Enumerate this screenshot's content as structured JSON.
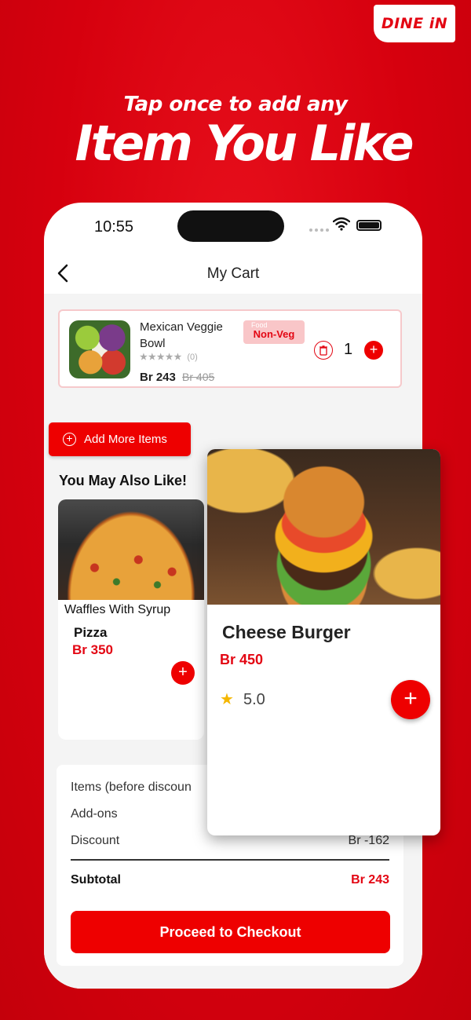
{
  "brand": {
    "logo_text": "DINE iN"
  },
  "hero": {
    "subtitle": "Tap once to add any",
    "title": "Item You Like"
  },
  "status_bar": {
    "time": "10:55"
  },
  "nav": {
    "title": "My Cart"
  },
  "cart_item": {
    "name": "Mexican Veggie Bowl",
    "stars": "★★★★★",
    "rating_count": "(0)",
    "price": "Br 243",
    "original_price": "Br 405",
    "tag_small": "Food",
    "tag": "Non-Veg",
    "quantity": "1",
    "plus": "+"
  },
  "add_more": {
    "icon": "+",
    "label": "Add More Items"
  },
  "recommend": {
    "heading": "You May Also Like!",
    "pizza": {
      "caption": "Waffles With Syrup",
      "name": "Pizza",
      "price": "Br 350",
      "plus": "+"
    },
    "burger": {
      "name": "Cheese Burger",
      "price": "Br 450",
      "star": "★",
      "rating": "5.0",
      "plus": "+"
    }
  },
  "summary": {
    "items_label": "Items (before discoun",
    "addons_label": "Add-ons",
    "discount_label": "Discount",
    "discount_value": "Br -162",
    "subtotal_label": "Subtotal",
    "subtotal_value": "Br 243",
    "checkout_label": "Proceed to Checkout"
  },
  "colors": {
    "brand_red": "#e30613",
    "button_red": "#ee0000",
    "tag_bg": "#f9c6c8"
  }
}
